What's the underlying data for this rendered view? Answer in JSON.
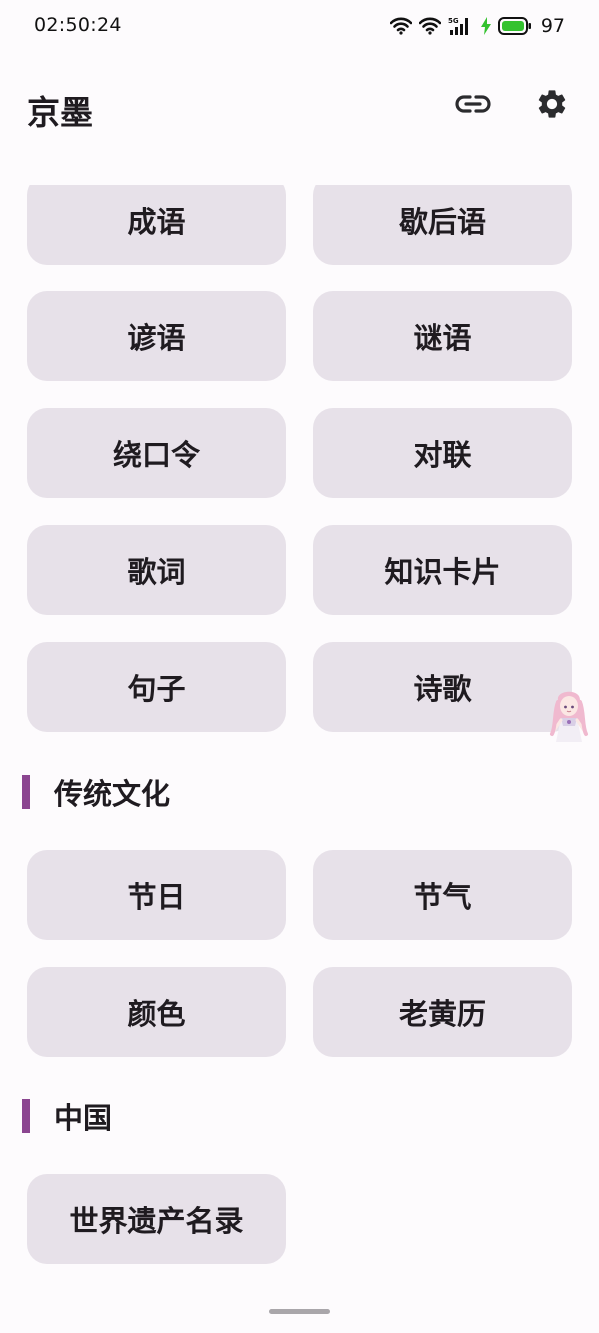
{
  "status_bar": {
    "time": "02:50:24",
    "battery": "97",
    "network": "5G"
  },
  "app_bar": {
    "title": "京墨"
  },
  "language_tiles": [
    {
      "label": "成语"
    },
    {
      "label": "歇后语"
    },
    {
      "label": "谚语"
    },
    {
      "label": "谜语"
    },
    {
      "label": "绕口令"
    },
    {
      "label": "对联"
    },
    {
      "label": "歌词"
    },
    {
      "label": "知识卡片"
    },
    {
      "label": "句子"
    },
    {
      "label": "诗歌"
    }
  ],
  "traditional_culture": {
    "title": "传统文化",
    "tiles": [
      {
        "label": "节日"
      },
      {
        "label": "节气"
      },
      {
        "label": "颜色"
      },
      {
        "label": "老黄历"
      }
    ]
  },
  "china": {
    "title": "中国",
    "tiles": [
      {
        "label": "世界遗产名录"
      }
    ]
  },
  "colors": {
    "accent": "#8b4590",
    "tile_bg": "#e7e1e9",
    "background": "#fdfbfd",
    "battery_fill": "#34c22f"
  }
}
